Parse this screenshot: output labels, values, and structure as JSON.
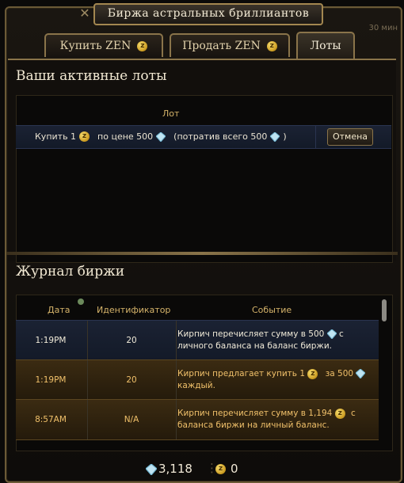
{
  "window": {
    "title": "Биржа астральных бриллиантов",
    "corner_text": "30 мин"
  },
  "tabs": [
    {
      "label": "Купить ZEN"
    },
    {
      "label": "Продать ZEN"
    },
    {
      "label": "Лоты"
    }
  ],
  "lots": {
    "title": "Ваши активные лоты",
    "column": "Лот",
    "row": {
      "buy_prefix": "Купить 1",
      "price_text": "по цене 500",
      "total_prefix": "(потратив всего 500",
      "total_suffix": ")",
      "cancel_label": "Отмена"
    }
  },
  "journal": {
    "title": "Журнал биржи",
    "columns": [
      "Дата",
      "Идентификатор",
      "Событие"
    ],
    "rows": [
      {
        "time": "1:19PM",
        "id": "20",
        "event_a": "Кирпич перечисляет сумму в 500",
        "event_b": "с",
        "event_c": "личного баланса на баланс биржи."
      },
      {
        "time": "1:19PM",
        "id": "20",
        "event_a": "Кирпич предлагает купить 1",
        "event_b": "за 500",
        "event_c": "каждый."
      },
      {
        "time": "8:57AM",
        "id": "N/A",
        "event_a": "Кирпич перечисляет сумму в 1,194",
        "event_b": "с",
        "event_c": "баланса биржи на личный баланс."
      }
    ]
  },
  "footer": {
    "diamonds": "3,118",
    "zen": "0"
  },
  "colors": {
    "accent_gold": "#8a744a",
    "row_blue": "#1b2233",
    "row_gold": "#3b2b12"
  }
}
